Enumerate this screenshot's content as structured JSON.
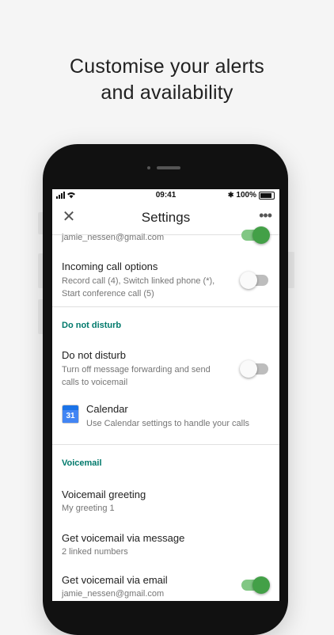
{
  "headline": {
    "line1": "Customise your alerts",
    "line2": "and availability"
  },
  "status_bar": {
    "time": "09:41",
    "battery": "100%"
  },
  "app_bar": {
    "title": "Settings"
  },
  "top_partial": {
    "subtitle": "jamie_nessen@gmail.com",
    "toggle_on": true
  },
  "incoming_call": {
    "title": "Incoming call options",
    "subtitle_line1": "Record call (4), Switch linked phone (*),",
    "subtitle_line2": "Start conference call (5)",
    "toggle_on": false
  },
  "dnd_section": {
    "header": "Do not disturb"
  },
  "dnd": {
    "title": "Do not disturb",
    "subtitle_line1": "Turn off message forwarding and send",
    "subtitle_line2": "calls to voicemail",
    "toggle_on": false
  },
  "calendar": {
    "icon_number": "31",
    "title": "Calendar",
    "subtitle": "Use Calendar settings to handle your calls"
  },
  "voicemail_section": {
    "header": "Voicemail"
  },
  "voicemail_greeting": {
    "title": "Voicemail greeting",
    "subtitle": "My greeting 1"
  },
  "voicemail_message": {
    "title": "Get voicemail via message",
    "subtitle": "2 linked numbers"
  },
  "voicemail_email": {
    "title": "Get voicemail via email",
    "subtitle": "jamie_nessen@gmail.com",
    "toggle_on": true
  },
  "colors": {
    "accent": "#00796b",
    "toggle_on": "#43a047"
  }
}
